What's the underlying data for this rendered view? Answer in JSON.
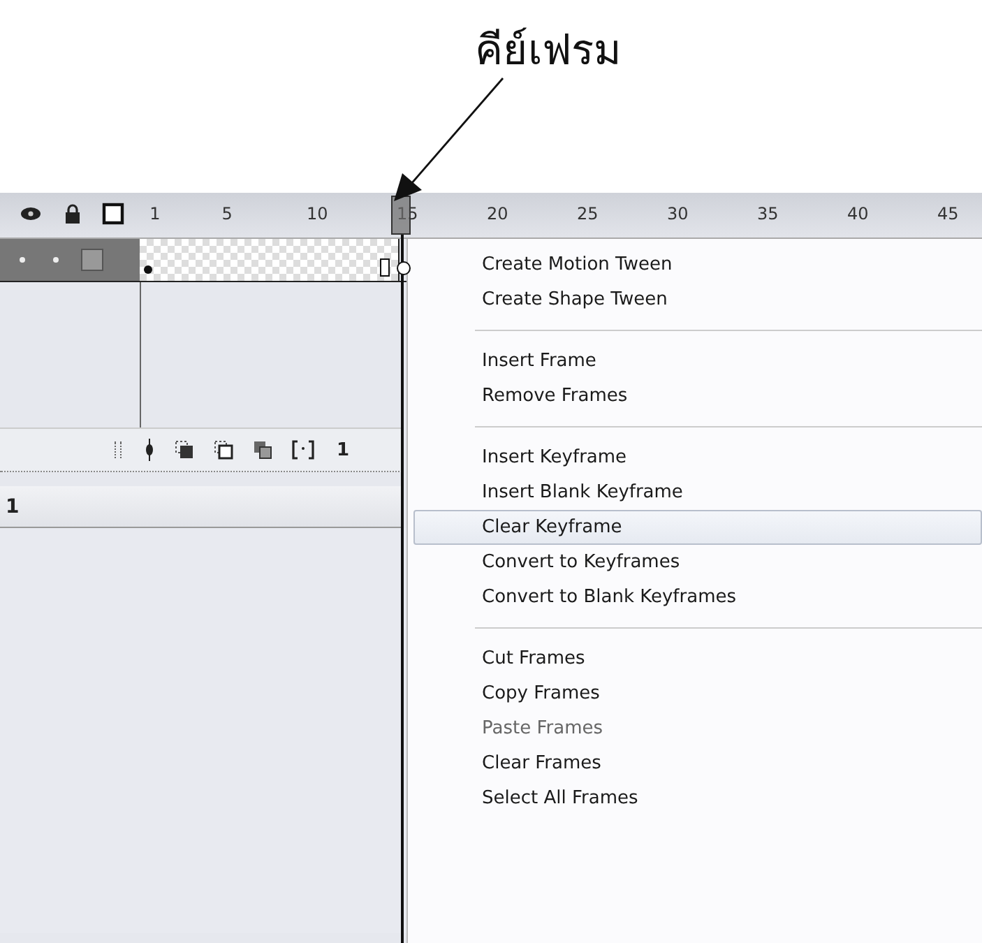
{
  "annotation": {
    "label": "คีย์เฟรม"
  },
  "timeline": {
    "ruler": [
      "1",
      "5",
      "10",
      "15",
      "20",
      "25",
      "30",
      "35",
      "40",
      "45"
    ],
    "layer": {
      "visible": true,
      "locked": false
    },
    "toolbar_frame": "1",
    "scene_label": "1"
  },
  "context_menu": {
    "groups": [
      [
        {
          "label": "Create Motion Tween",
          "selected": false,
          "disabled": false
        },
        {
          "label": "Create Shape Tween",
          "selected": false,
          "disabled": false
        }
      ],
      [
        {
          "label": "Insert Frame",
          "selected": false,
          "disabled": false
        },
        {
          "label": "Remove Frames",
          "selected": false,
          "disabled": false
        }
      ],
      [
        {
          "label": "Insert Keyframe",
          "selected": false,
          "disabled": false
        },
        {
          "label": "Insert Blank Keyframe",
          "selected": false,
          "disabled": false
        },
        {
          "label": "Clear Keyframe",
          "selected": true,
          "disabled": false
        },
        {
          "label": "Convert to Keyframes",
          "selected": false,
          "disabled": false
        },
        {
          "label": "Convert to Blank Keyframes",
          "selected": false,
          "disabled": false
        }
      ],
      [
        {
          "label": "Cut Frames",
          "selected": false,
          "disabled": false
        },
        {
          "label": "Copy Frames",
          "selected": false,
          "disabled": false
        },
        {
          "label": "Paste Frames",
          "selected": false,
          "disabled": true
        },
        {
          "label": "Clear Frames",
          "selected": false,
          "disabled": false
        },
        {
          "label": "Select All Frames",
          "selected": false,
          "disabled": false
        }
      ]
    ]
  }
}
